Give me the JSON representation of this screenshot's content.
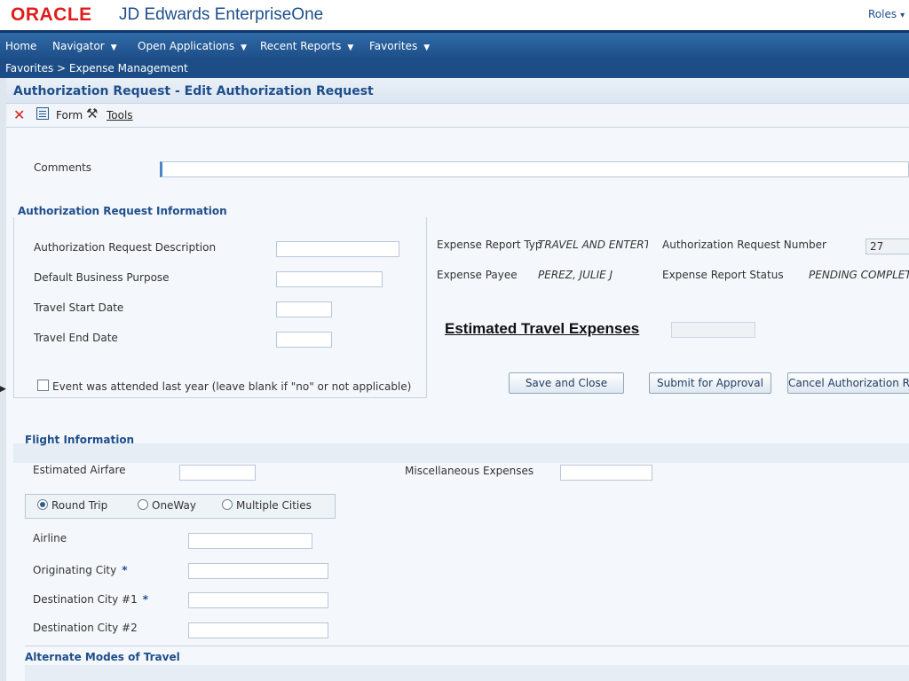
{
  "header": {
    "brand": "ORACLE",
    "app_name": "JD Edwards EnterpriseOne",
    "roles_label": "Roles"
  },
  "nav": {
    "home": "Home",
    "navigator": "Navigator",
    "open_applications": "Open Applications",
    "recent_reports": "Recent Reports",
    "favorites": "Favorites"
  },
  "breadcrumb": "Favorites  >  Expense Management",
  "page_title": "Authorization Request - Edit Authorization Request",
  "toolbar": {
    "close_icon": "close-icon",
    "form_label": "Form",
    "tools_label": "Tools"
  },
  "comments": {
    "label": "Comments",
    "value": ""
  },
  "auth_section": {
    "title": "Authorization Request Information",
    "description_label": "Authorization Request Description",
    "description_value": "",
    "business_purpose_label": "Default Business Purpose",
    "business_purpose_value": "",
    "start_date_label": "Travel Start Date",
    "start_date_value": "",
    "end_date_label": "Travel End Date",
    "end_date_value": "",
    "checkbox_label": "Event was attended last year (leave blank if \"no\" or not applicable)",
    "checkbox_checked": false
  },
  "info": {
    "expense_report_type_label": "Expense Report Typ",
    "expense_report_type_value": "TRAVEL AND ENTERTAI",
    "expense_payee_label": "Expense Payee",
    "expense_payee_value": "PEREZ, JULIE J",
    "auth_request_number_label": "Authorization Request Number",
    "auth_request_number_value": "27",
    "report_status_label": "Expense Report Status",
    "report_status_value": "PENDING COMPLETIO"
  },
  "estimated_travel": {
    "label": "Estimated Travel Expenses",
    "value": ""
  },
  "buttons": {
    "save_close": "Save and Close",
    "submit": "Submit for Approval",
    "cancel": "Cancel Authorization R"
  },
  "flight": {
    "title": "Flight Information",
    "airfare_label": "Estimated Airfare",
    "airfare_value": "",
    "misc_label": "Miscellaneous Expenses",
    "misc_value": "",
    "trip_options": [
      "Round Trip",
      "OneWay",
      "Multiple Cities"
    ],
    "trip_selected": "Round Trip",
    "airline_label": "Airline",
    "airline_value": "",
    "origin_label": "Originating City",
    "origin_value": "",
    "dest1_label": "Destination City #1",
    "dest1_value": "",
    "dest2_label": "Destination City #2",
    "dest2_value": "",
    "required_marker": "*"
  },
  "alternate": {
    "title": "Alternate Modes of Travel"
  },
  "colors": {
    "brand_red": "#e01c1c",
    "nav_blue": "#1e4f88",
    "title_blue": "#1f4e8c"
  }
}
